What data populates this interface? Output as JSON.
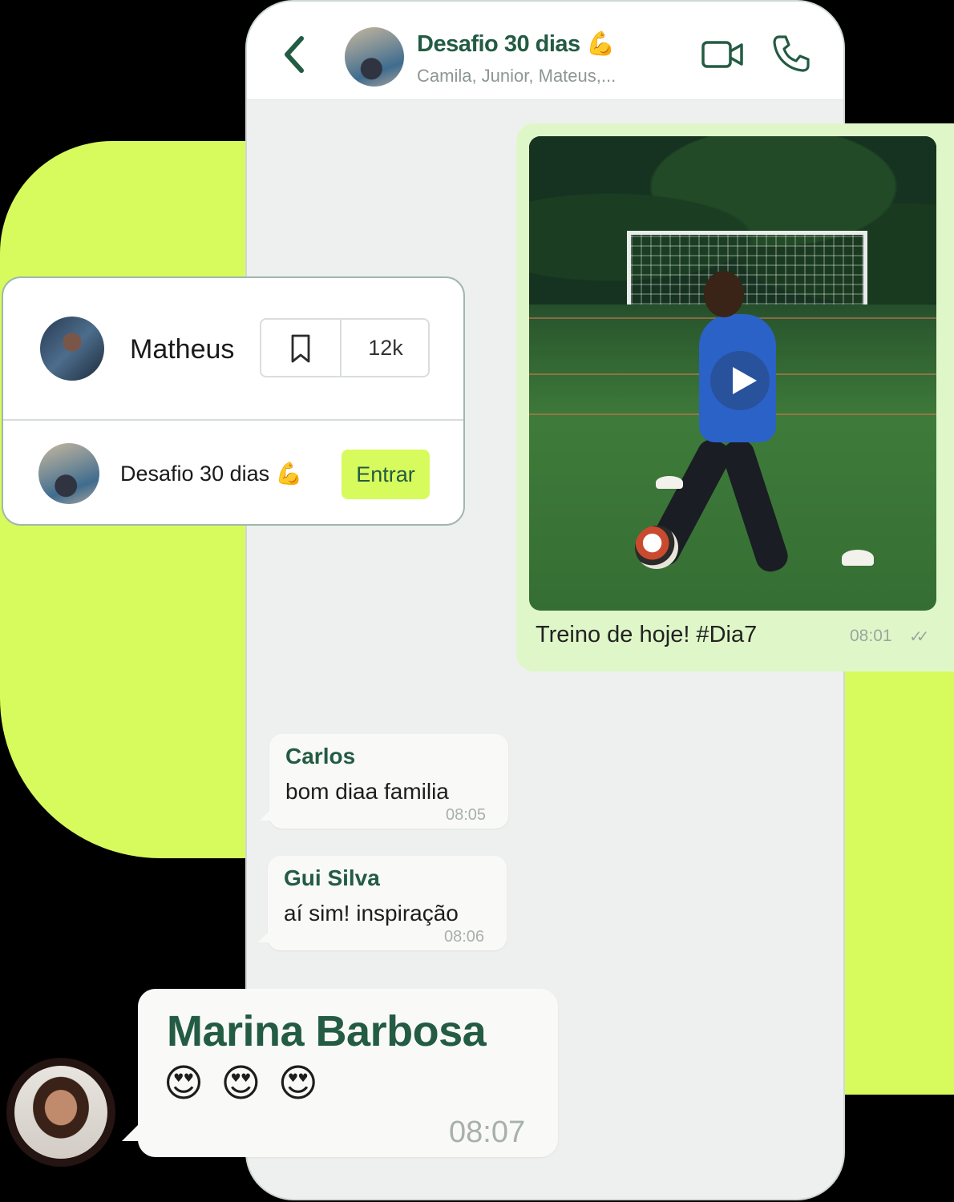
{
  "header": {
    "title": "Desafio 30 dias 💪",
    "subtitle": "Camila, Junior, Mateus,..."
  },
  "video_post": {
    "caption": "Treino de hoje! #Dia7",
    "time": "08:01"
  },
  "profile_card": {
    "name": "Matheus",
    "saved_count": "12k",
    "group_name": "Desafio 30 dias 💪",
    "join_label": "Entrar"
  },
  "messages": [
    {
      "sender": "Carlos",
      "text": "bom diaa familia",
      "time": "08:05"
    },
    {
      "sender": "Gui Silva",
      "text": "aí sim! inspiração",
      "time": "08:06"
    },
    {
      "sender": "Marina Barbosa",
      "text": "😍 😍 😍",
      "time": "08:07"
    }
  ],
  "colors": {
    "accent": "#d7fb5d",
    "brand_green": "#235b43",
    "video_bubble": "#dff7c8"
  }
}
